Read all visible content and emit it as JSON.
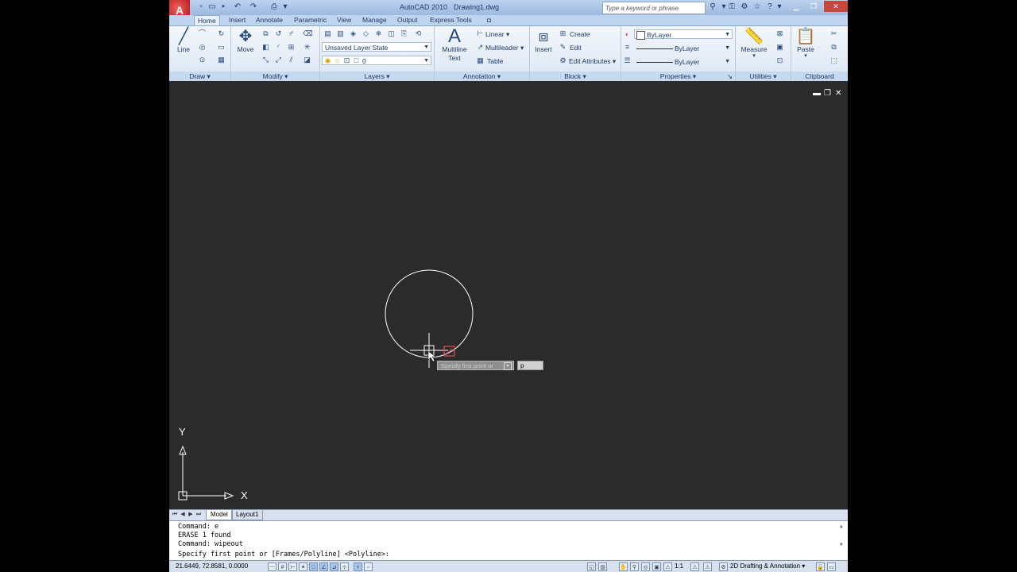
{
  "titlebar": {
    "app_title": "AutoCAD 2010",
    "doc_title": "Drawing1.dwg",
    "search_placeholder": "Type a keyword or phrase",
    "app_button": "A"
  },
  "tabs": [
    "Home",
    "Insert",
    "Annotate",
    "Parametric",
    "View",
    "Manage",
    "Output",
    "Express Tools"
  ],
  "ribbon": {
    "draw": {
      "title": "Draw",
      "line_label": "Line"
    },
    "modify": {
      "title": "Modify",
      "move_label": "Move"
    },
    "layers": {
      "title": "Layers",
      "layer_state": "Unsaved Layer State",
      "current_layer": "0"
    },
    "annotation": {
      "title": "Annotation",
      "multiline_text": "Multiline Text",
      "linear": "Linear",
      "multileader": "Multileader",
      "table": "Table"
    },
    "block": {
      "title": "Block",
      "insert": "Insert",
      "create": "Create",
      "edit": "Edit",
      "edit_attributes": "Edit Attributes"
    },
    "properties": {
      "title": "Properties",
      "color": "ByLayer",
      "linetype": "ByLayer",
      "lineweight": "ByLayer"
    },
    "utilities": {
      "title": "Utilities",
      "measure": "Measure"
    },
    "clipboard": {
      "title": "Clipboard",
      "paste": "Paste"
    }
  },
  "drawing": {
    "ucs_x": "X",
    "ucs_y": "Y",
    "tooltip_prompt": "Specify first point or",
    "dynamic_input_value": "p"
  },
  "layout_tabs": [
    "Model",
    "Layout1"
  ],
  "command_lines": [
    "Command: e",
    "ERASE 1 found",
    "Command: wipeout",
    "Specify first point or [Frames/Polyline] <Polyline>:"
  ],
  "status": {
    "coords": "21.6449, 72.8581, 0.0000",
    "scale": "1:1",
    "workspace": "2D Drafting & Annotation"
  }
}
